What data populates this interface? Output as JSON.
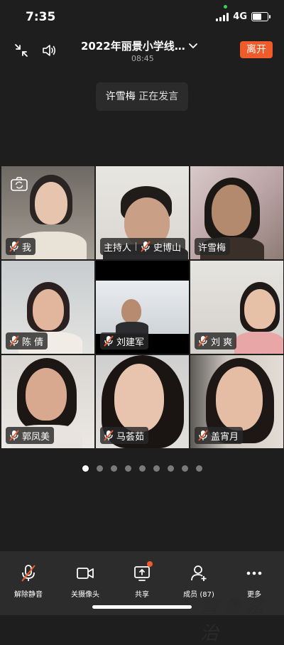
{
  "status": {
    "time": "7:35",
    "network": "4G"
  },
  "header": {
    "title": "2022年丽景小学线…",
    "timer": "08:45",
    "leave_label": "离开"
  },
  "speaking": {
    "name": "许雪梅",
    "status": "正在发言"
  },
  "participants": [
    {
      "name": "我"
    },
    {
      "host_label": "主持人",
      "name": "史博山"
    },
    {
      "name": "许雪梅"
    },
    {
      "name": "陈 倩"
    },
    {
      "name": "刘建军"
    },
    {
      "name": "刘 爽"
    },
    {
      "name": "郭凤美"
    },
    {
      "name": "马荟茹"
    },
    {
      "name": "盖宵月"
    }
  ],
  "pagination": {
    "total": 9,
    "current": 1
  },
  "toolbar": {
    "unmute": "解除静音",
    "camera_off": "关摄像头",
    "share": "共享",
    "members": "成员 (87)",
    "more": "更多"
  },
  "watermark": "齊魯法治",
  "colors": {
    "accent": "#f05b2c",
    "active_border": "#3ac86d"
  }
}
